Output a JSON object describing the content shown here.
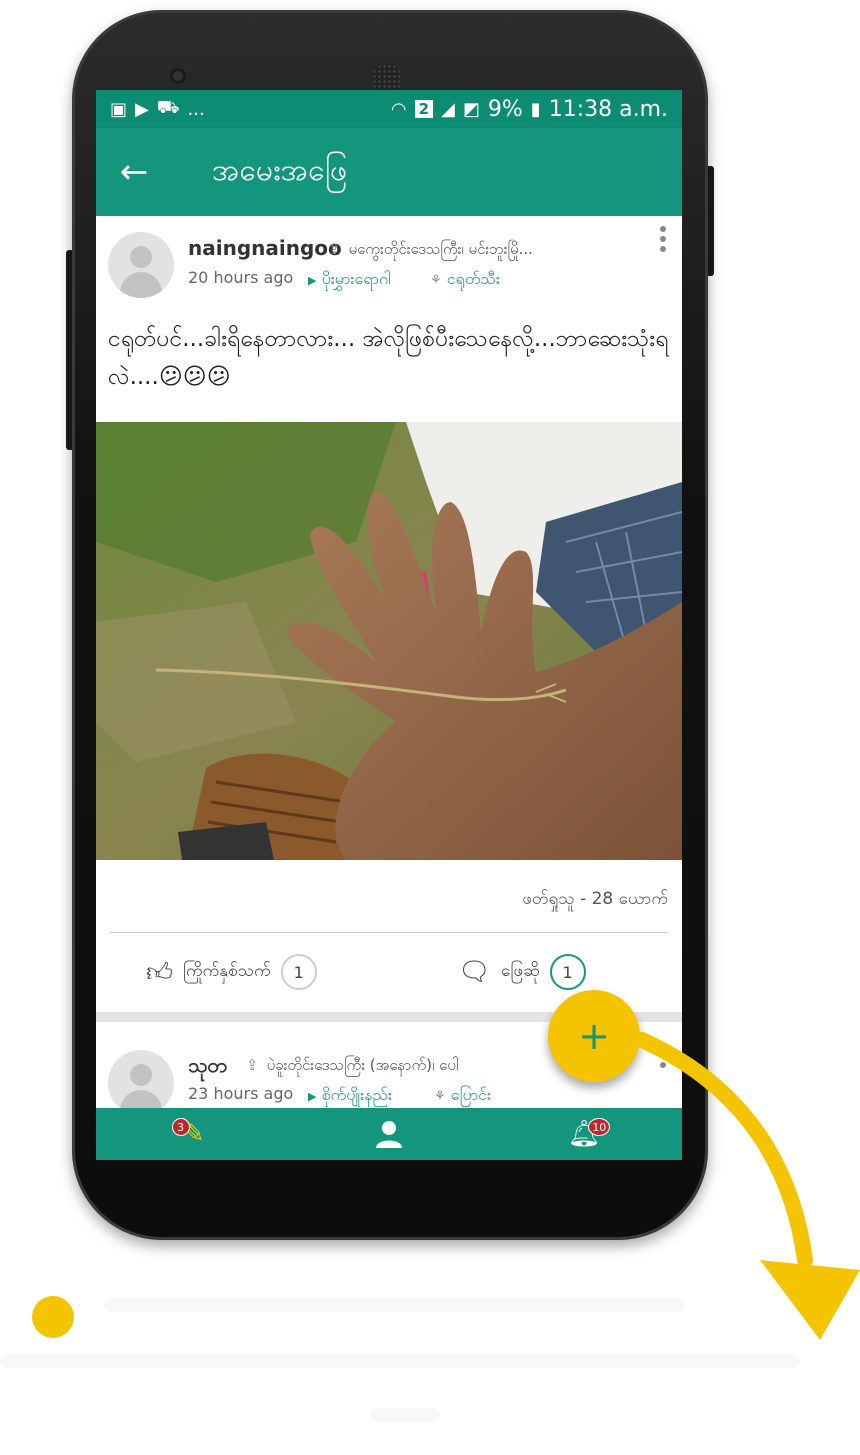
{
  "status_bar": {
    "left_text": "...",
    "sim": "2",
    "battery": "9%",
    "time": "11:38 a.m."
  },
  "app_bar": {
    "back_icon": "arrow-left-icon",
    "title": "အမေးအဖြေ"
  },
  "post": {
    "username": "naingnaingoo",
    "location": "မကွေးတိုင်းဒေသကြီး၊ မင်းဘူးမြို...",
    "time_ago": "20 hours ago",
    "category": "ပိုးမွှားရောဂါ",
    "crop": "ငရုတ်သီး",
    "text": "ငရုတ်ပင်...ခါးရိနေတာလား... အဲလိုဖြစ်ပီးသေနေလို့...ဘာဆေးသုံးရလဲ....",
    "emojis": [
      "😕",
      "😕",
      "😕"
    ],
    "views": "ဖတ်ရှုသူ - 28 ယောက်",
    "like_label": "ကြိုက်နှစ်သက်",
    "like_count": "1",
    "answer_label": "ဖြေဆို",
    "answer_count": "1"
  },
  "post2": {
    "username": "သုတ",
    "location": "ပဲခူးတိုင်းဒေသကြီး (အနောက်)၊ ပေါ",
    "time_ago": "23 hours ago",
    "category": "စိုက်ပျိုးနည်း",
    "crop": "ပြောင်း"
  },
  "bottom_nav": {
    "items": [
      {
        "icon": "questions-icon",
        "badge": "3"
      },
      {
        "icon": "profile-icon",
        "badge": ""
      },
      {
        "icon": "notification-bell-icon",
        "badge": "10"
      }
    ]
  },
  "fab": {
    "icon": "plus-icon",
    "label": "+"
  },
  "colors": {
    "primary": "#14967c",
    "status": "#0d8c74",
    "accent": "#f5c400"
  }
}
